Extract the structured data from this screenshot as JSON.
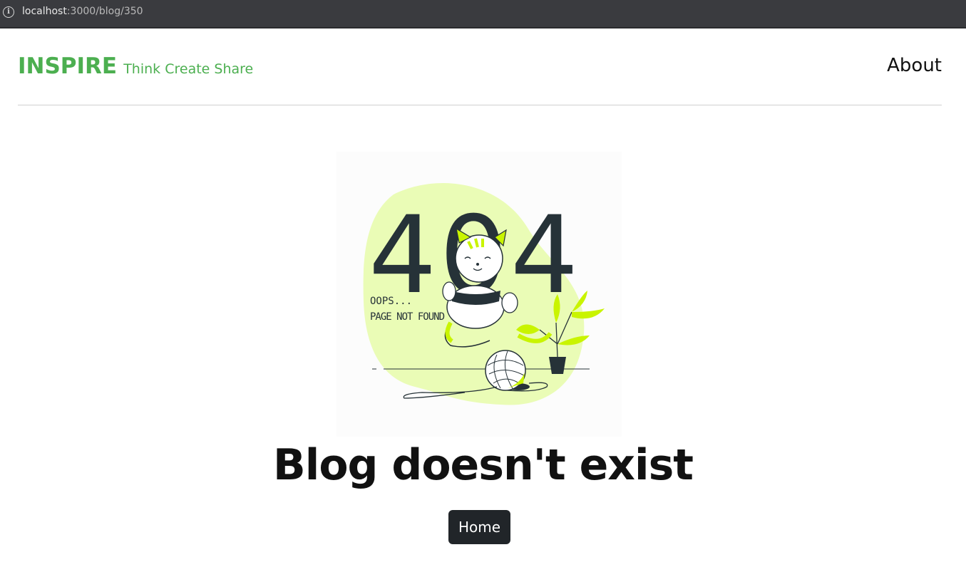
{
  "browser": {
    "url_host": "localhost",
    "url_path": ":3000/blog/350",
    "info_icon": "info-icon"
  },
  "header": {
    "brand_name": "INSPIRE",
    "tagline": "Think Create Share",
    "about_label": "About"
  },
  "illustration": {
    "code": "404",
    "oops_line1": "OOPS...",
    "oops_line2": "PAGE NOT FOUND",
    "icon": "cat-404-illustration",
    "accent": "#c9f400",
    "blob": "#eafcb6"
  },
  "main": {
    "title": "Blog doesn't exist",
    "home_label": "Home"
  },
  "colors": {
    "brand": "#4caf50",
    "button": "#212529",
    "browser_bar": "#3a3b3f"
  }
}
